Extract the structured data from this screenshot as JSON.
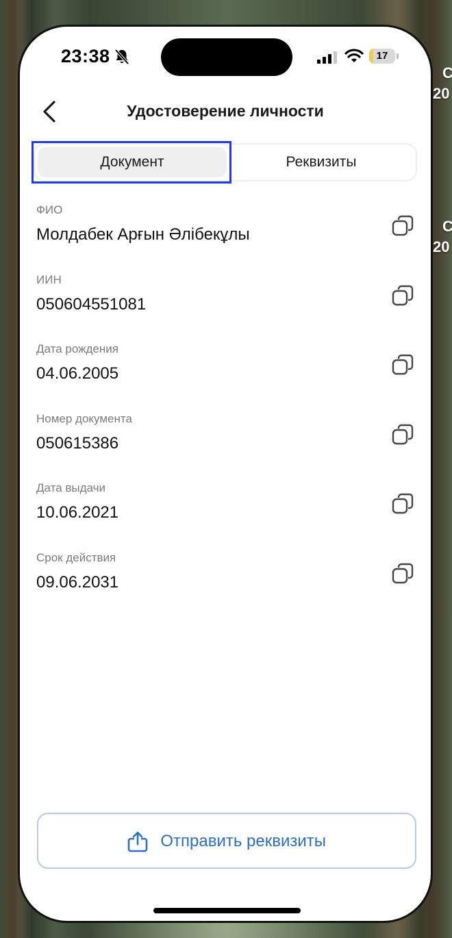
{
  "background": {
    "overlay_lines": [
      "С",
      "20",
      "С",
      "20"
    ]
  },
  "status_bar": {
    "time": "23:38",
    "battery_percent": 17,
    "battery_label": "17"
  },
  "nav": {
    "title": "Удостоверение личности"
  },
  "tabs": [
    {
      "label": "Документ",
      "active": true
    },
    {
      "label": "Реквизиты",
      "active": false
    }
  ],
  "fields": [
    {
      "label": "ФИО",
      "value": "Молдабек Арғын Әлібекұлы"
    },
    {
      "label": "ИИН",
      "value": "050604551081"
    },
    {
      "label": "Дата рождения",
      "value": "04.06.2005"
    },
    {
      "label": "Номер документа",
      "value": "050615386"
    },
    {
      "label": "Дата выдачи",
      "value": "10.06.2021"
    },
    {
      "label": "Срок действия",
      "value": "09.06.2031"
    }
  ],
  "footer": {
    "send_label": "Отправить реквизиты"
  },
  "colors": {
    "accent": "#2c6fc0",
    "highlight": "#1f3bdc",
    "battery": "#f5cc4a"
  }
}
